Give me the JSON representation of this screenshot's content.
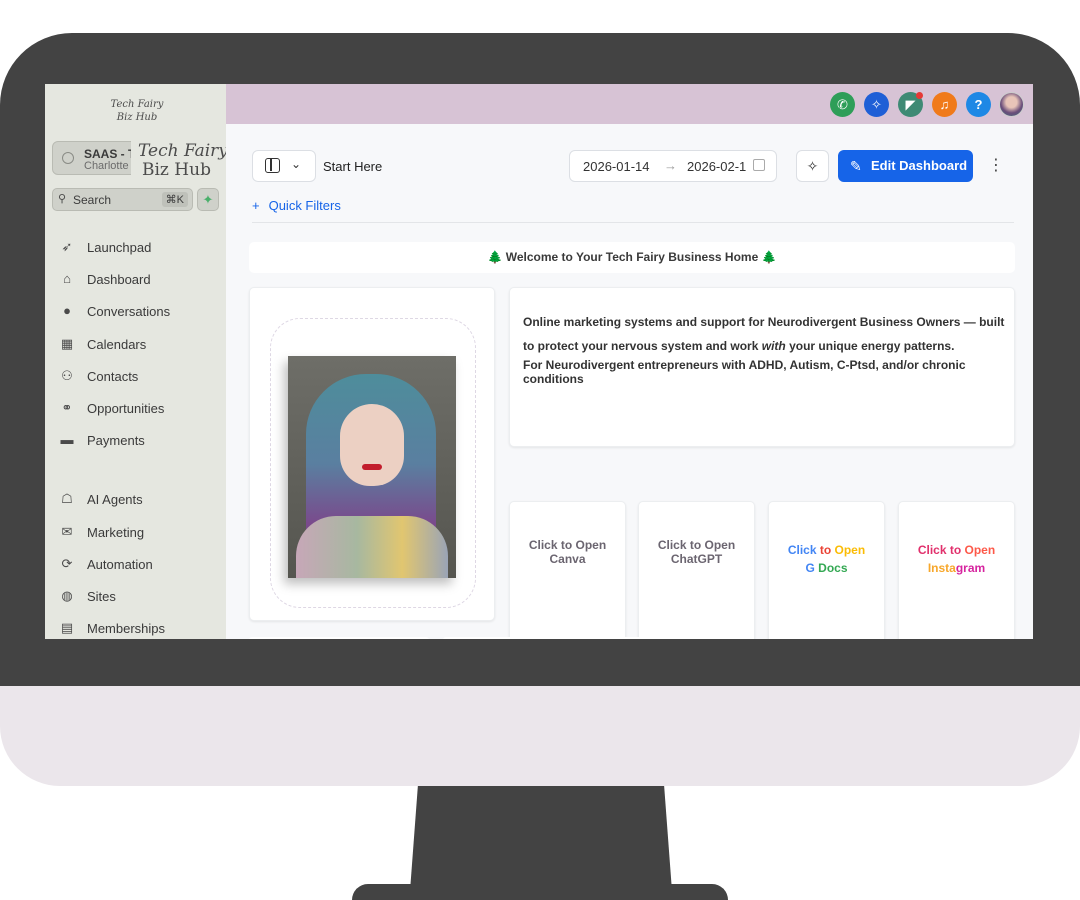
{
  "brand": {
    "logo_line1": "Tech Fairy",
    "logo_line2": "Biz Hub"
  },
  "account": {
    "name": "SAAS - T",
    "sub": "Charlotte"
  },
  "search": {
    "label": "Search",
    "shortcut": "⌘K"
  },
  "sidebar": {
    "items": [
      {
        "label": "Launchpad",
        "icon": "rocket-icon"
      },
      {
        "label": "Dashboard",
        "icon": "home-icon"
      },
      {
        "label": "Conversations",
        "icon": "chat-icon"
      },
      {
        "label": "Calendars",
        "icon": "calendar-icon"
      },
      {
        "label": "Contacts",
        "icon": "users-icon"
      },
      {
        "label": "Opportunities",
        "icon": "handshake-icon"
      },
      {
        "label": "Payments",
        "icon": "credit-card-icon"
      },
      {
        "label": "AI Agents",
        "icon": "robot-icon"
      },
      {
        "label": "Marketing",
        "icon": "envelope-icon"
      },
      {
        "label": "Automation",
        "icon": "sync-icon"
      },
      {
        "label": "Sites",
        "icon": "globe-icon"
      },
      {
        "label": "Memberships",
        "icon": "id-badge-icon"
      }
    ]
  },
  "topbar": {
    "buttons": [
      {
        "icon": "phone-icon",
        "color": "#2e9e58"
      },
      {
        "icon": "sparkle-icon",
        "color": "#1f5fd6"
      },
      {
        "icon": "megaphone-icon",
        "color": "#3e8a74"
      },
      {
        "icon": "bell-icon",
        "color": "#f07a1a"
      },
      {
        "icon": "help-icon",
        "color": "#1e88e5"
      }
    ]
  },
  "toolbar": {
    "dashboard_name": "Start Here",
    "date_from": "2026-01-14",
    "date_to": "2026-02-1",
    "edit_label": "Edit Dashboard",
    "quick_filters": "Quick Filters",
    "accent": "#1664e8"
  },
  "dashboard": {
    "welcome": "🌲 Welcome to Your Tech Fairy Business Home 🌲",
    "intro_part1": "Online marketing systems and support for Neurodivergent Business Owners — built to protect your nervous system and work ",
    "intro_emph": "with",
    "intro_part2": " your unique energy patterns.",
    "intro_line2": "For Neurodivergent entrepreneurs with ADHD, Autism, C-Ptsd, and/or chronic conditions",
    "apps": [
      {
        "line1": "Click to Open",
        "line2": "Canva"
      },
      {
        "line1": "Click to Open",
        "line2": "ChatGPT"
      },
      {
        "w1": "Click",
        "w2": "to",
        "w3": "Open",
        "w4": "G",
        "w5": "Docs"
      },
      {
        "w1": "Click",
        "w2": "to",
        "w3": "Open",
        "w4": "Insta",
        "w5": "gram"
      }
    ]
  }
}
